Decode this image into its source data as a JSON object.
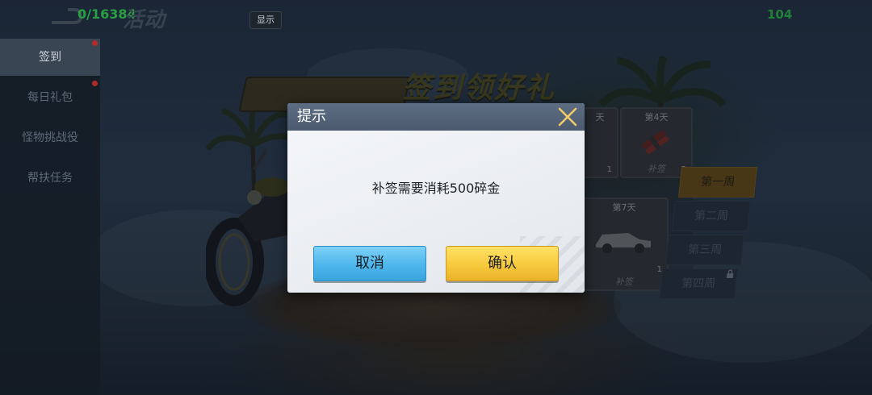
{
  "top_bar": {
    "counter": "0/16384",
    "title": "活动",
    "show_button": "显示",
    "right_number": "104"
  },
  "sidebar": {
    "items": [
      {
        "label": "签到",
        "active": true,
        "badge": true
      },
      {
        "label": "每日礼包",
        "active": false,
        "badge": true
      },
      {
        "label": "怪物挑战役",
        "active": false,
        "badge": false
      },
      {
        "label": "帮扶任务",
        "active": false,
        "badge": false
      }
    ]
  },
  "event": {
    "banner_title": "签到领好礼",
    "day_cards": [
      {
        "day": "天",
        "count": "1",
        "footer": ""
      },
      {
        "day": "第4天",
        "count": "2",
        "footer": "补签"
      },
      {
        "day": "第7天",
        "count": "1",
        "footer": "补签"
      }
    ],
    "weeks": [
      {
        "label": "第一周",
        "active": true,
        "locked": false
      },
      {
        "label": "第二周",
        "active": false,
        "locked": false
      },
      {
        "label": "第三周",
        "active": false,
        "locked": false
      },
      {
        "label": "第四周",
        "active": false,
        "locked": true
      }
    ]
  },
  "dialog": {
    "title": "提示",
    "message": "补签需要消耗500碎金",
    "cancel_label": "取消",
    "confirm_label": "确认"
  },
  "colors": {
    "cancel_button": "#4db6ec",
    "confirm_button": "#f7c93c",
    "dialog_header": "#54637a",
    "counter_green": "#28a043"
  },
  "icons": [
    "back-arrow-icon",
    "close-icon",
    "lock-icon"
  ]
}
